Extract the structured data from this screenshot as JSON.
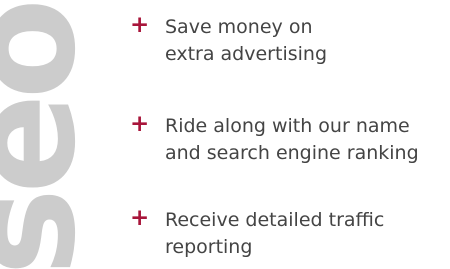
{
  "watermark": {
    "text": "seo",
    "color": "#cccccc"
  },
  "benefits": [
    {
      "icon": "plus-icon",
      "marker": "+",
      "text": "Save money on\nextra advertising"
    },
    {
      "icon": "plus-icon",
      "marker": "+",
      "text": "Ride along with our name\nand search engine ranking"
    },
    {
      "icon": "plus-icon",
      "marker": "+",
      "text": "Receive detailed traffic\nreporting"
    }
  ],
  "colors": {
    "accent": "#a8153a",
    "text": "#444444"
  }
}
